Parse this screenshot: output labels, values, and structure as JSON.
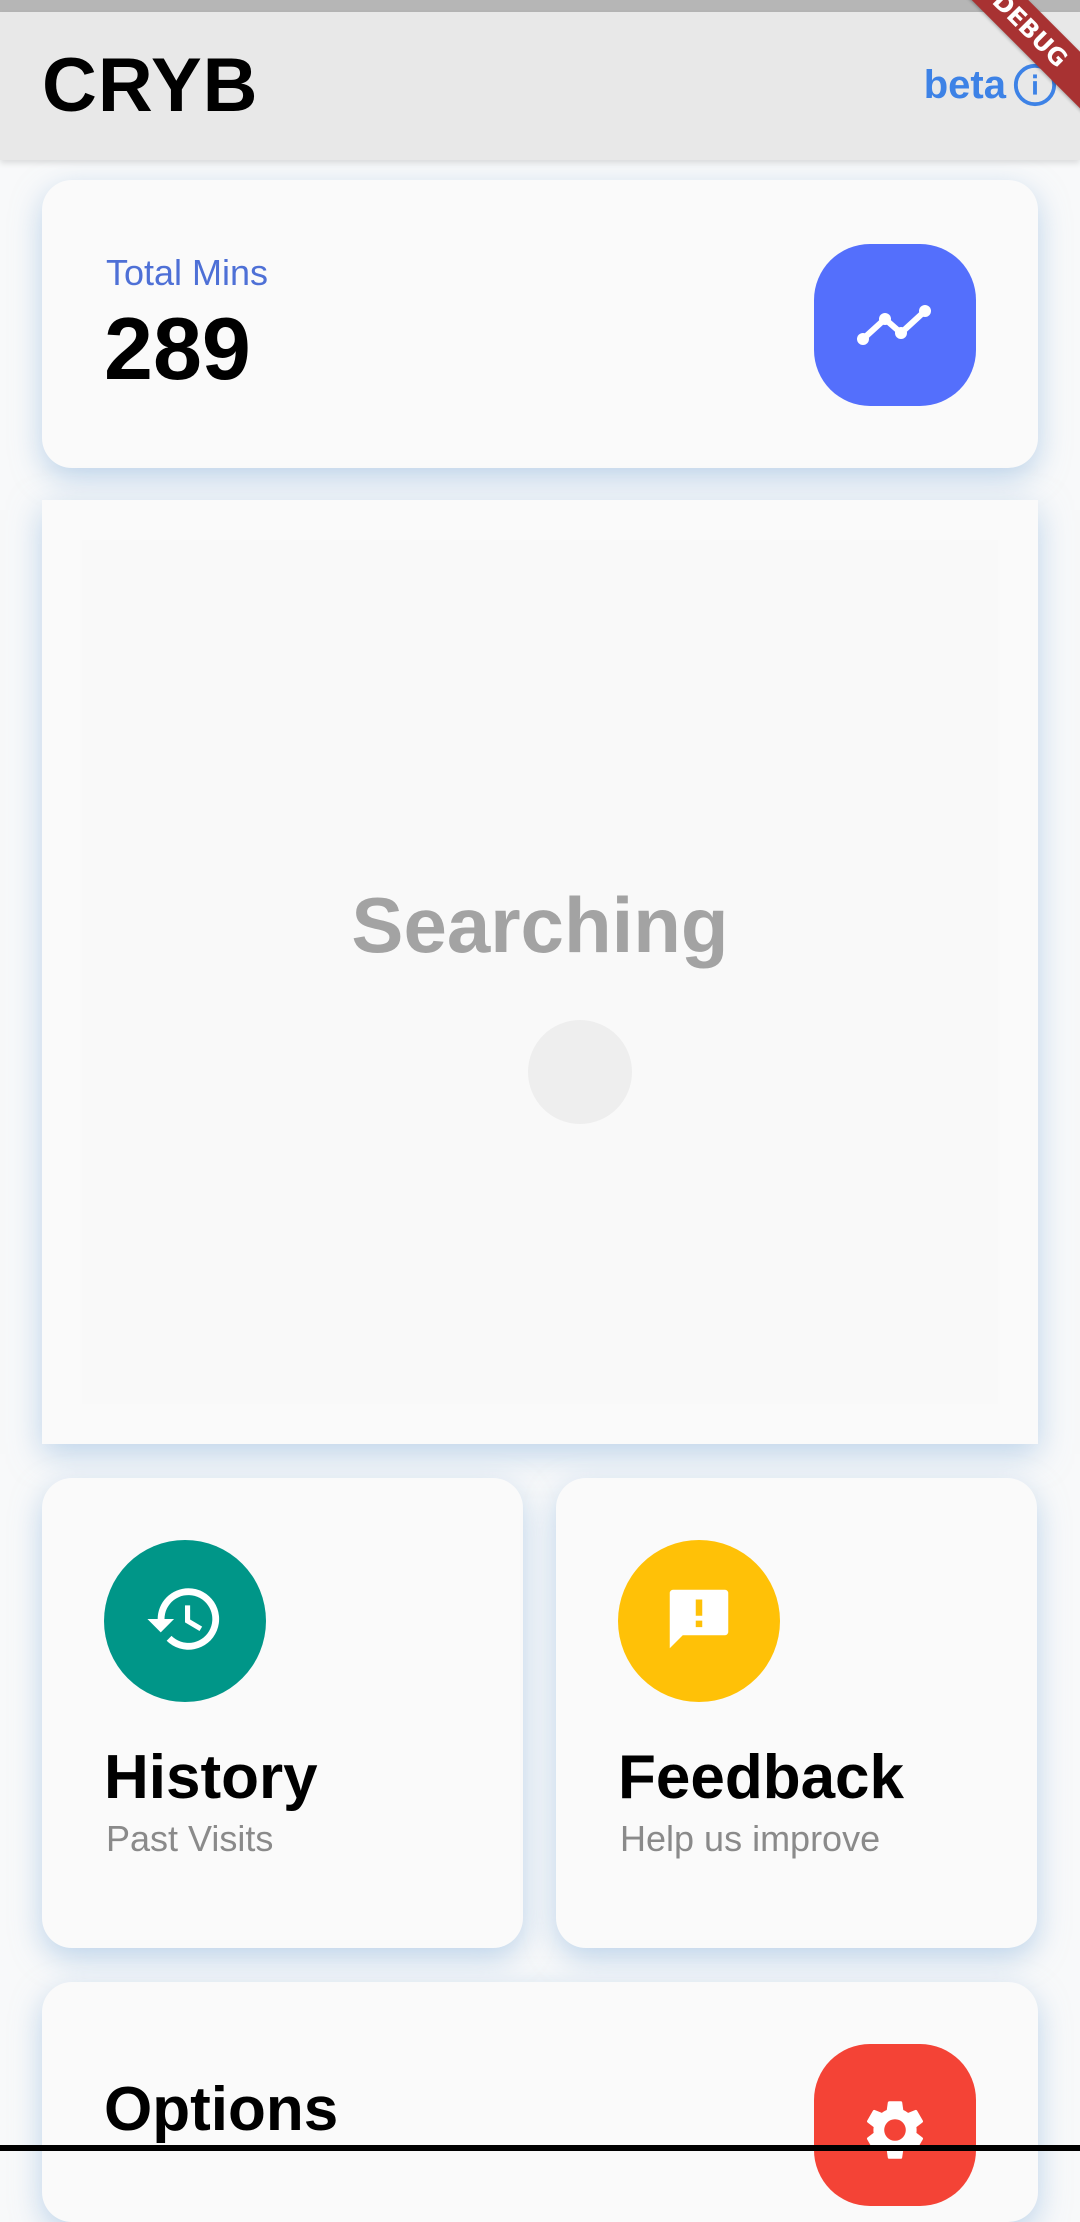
{
  "app": {
    "title": "CRYB",
    "beta_label": "beta",
    "debug_banner": "DEBUG"
  },
  "stats": {
    "label": "Total Mins",
    "value": "289",
    "trend_icon": "trending-up-icon"
  },
  "search": {
    "status_text": "Searching"
  },
  "tiles": [
    {
      "title": "History",
      "subtitle": "Past Visits",
      "icon": "history-icon",
      "color": "#009688"
    },
    {
      "title": "Feedback",
      "subtitle": "Help us improve",
      "icon": "feedback-icon",
      "color": "#ffc107"
    }
  ],
  "options": {
    "title": "Options",
    "icon": "gear-icon",
    "color": "#f44336"
  },
  "colors": {
    "accent_blue": "#546ffc",
    "link_blue": "#3d82e6"
  }
}
